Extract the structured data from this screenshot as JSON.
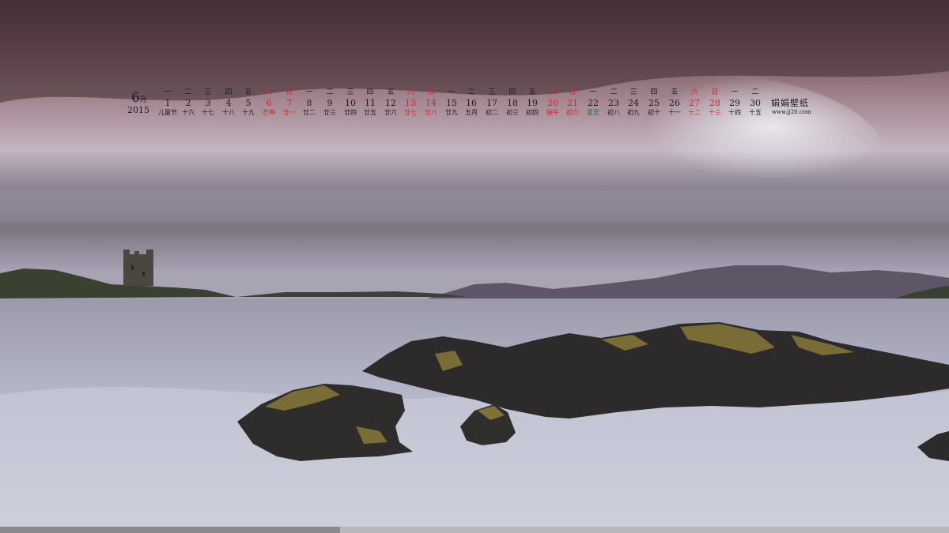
{
  "calendar": {
    "month_number": "6",
    "month_suffix": "月",
    "year": "2015",
    "brand": "娟娟壁纸",
    "url": "www.jj20.com",
    "colors": {
      "normal": "#1b1b22",
      "weekend": "#d8202a",
      "solar_term": "#2e7a2c"
    },
    "days": [
      {
        "wd": "一",
        "day": "1",
        "lunar": "儿童节",
        "wd_style": "normal",
        "lunar_style": "normal"
      },
      {
        "wd": "二",
        "day": "2",
        "lunar": "十六",
        "wd_style": "normal",
        "lunar_style": "normal"
      },
      {
        "wd": "三",
        "day": "3",
        "lunar": "十七",
        "wd_style": "normal",
        "lunar_style": "normal"
      },
      {
        "wd": "四",
        "day": "4",
        "lunar": "十八",
        "wd_style": "normal",
        "lunar_style": "normal"
      },
      {
        "wd": "五",
        "day": "5",
        "lunar": "十九",
        "wd_style": "normal",
        "lunar_style": "normal"
      },
      {
        "wd": "六",
        "day": "6",
        "lunar": "芒种",
        "wd_style": "red",
        "lunar_style": "red"
      },
      {
        "wd": "日",
        "day": "7",
        "lunar": "廿一",
        "wd_style": "red",
        "lunar_style": "red"
      },
      {
        "wd": "一",
        "day": "8",
        "lunar": "廿二",
        "wd_style": "normal",
        "lunar_style": "normal"
      },
      {
        "wd": "二",
        "day": "9",
        "lunar": "廿三",
        "wd_style": "normal",
        "lunar_style": "normal"
      },
      {
        "wd": "三",
        "day": "10",
        "lunar": "廿四",
        "wd_style": "normal",
        "lunar_style": "normal"
      },
      {
        "wd": "四",
        "day": "11",
        "lunar": "廿五",
        "wd_style": "normal",
        "lunar_style": "normal"
      },
      {
        "wd": "五",
        "day": "12",
        "lunar": "廿六",
        "wd_style": "normal",
        "lunar_style": "normal"
      },
      {
        "wd": "六",
        "day": "13",
        "lunar": "廿七",
        "wd_style": "red",
        "lunar_style": "red"
      },
      {
        "wd": "日",
        "day": "14",
        "lunar": "廿八",
        "wd_style": "red",
        "lunar_style": "red"
      },
      {
        "wd": "一",
        "day": "15",
        "lunar": "廿九",
        "wd_style": "normal",
        "lunar_style": "normal"
      },
      {
        "wd": "二",
        "day": "16",
        "lunar": "五月",
        "wd_style": "normal",
        "lunar_style": "normal"
      },
      {
        "wd": "三",
        "day": "17",
        "lunar": "初二",
        "wd_style": "normal",
        "lunar_style": "normal"
      },
      {
        "wd": "四",
        "day": "18",
        "lunar": "初三",
        "wd_style": "normal",
        "lunar_style": "normal"
      },
      {
        "wd": "五",
        "day": "19",
        "lunar": "初四",
        "wd_style": "normal",
        "lunar_style": "normal"
      },
      {
        "wd": "六",
        "day": "20",
        "lunar": "端午",
        "wd_style": "red",
        "lunar_style": "red"
      },
      {
        "wd": "日",
        "day": "21",
        "lunar": "初六",
        "wd_style": "red",
        "lunar_style": "red"
      },
      {
        "wd": "一",
        "day": "22",
        "lunar": "夏至",
        "wd_style": "normal",
        "lunar_style": "green"
      },
      {
        "wd": "二",
        "day": "23",
        "lunar": "初八",
        "wd_style": "normal",
        "lunar_style": "normal"
      },
      {
        "wd": "三",
        "day": "24",
        "lunar": "初九",
        "wd_style": "normal",
        "lunar_style": "normal"
      },
      {
        "wd": "四",
        "day": "25",
        "lunar": "初十",
        "wd_style": "normal",
        "lunar_style": "normal"
      },
      {
        "wd": "五",
        "day": "26",
        "lunar": "十一",
        "wd_style": "normal",
        "lunar_style": "normal"
      },
      {
        "wd": "六",
        "day": "27",
        "lunar": "十二",
        "wd_style": "red",
        "lunar_style": "red"
      },
      {
        "wd": "日",
        "day": "28",
        "lunar": "十三",
        "wd_style": "red",
        "lunar_style": "red"
      },
      {
        "wd": "一",
        "day": "29",
        "lunar": "十四",
        "wd_style": "normal",
        "lunar_style": "normal"
      },
      {
        "wd": "二",
        "day": "30",
        "lunar": "十五",
        "wd_style": "normal",
        "lunar_style": "normal"
      }
    ]
  },
  "scene": {
    "sky_colors": [
      "#5a3f45",
      "#8a6a72",
      "#b59aa4",
      "#c9c0cc"
    ],
    "water_color": "#b9bccd",
    "rock_color": "#2c2a2b",
    "lichen_color": "#9a8a3a"
  }
}
